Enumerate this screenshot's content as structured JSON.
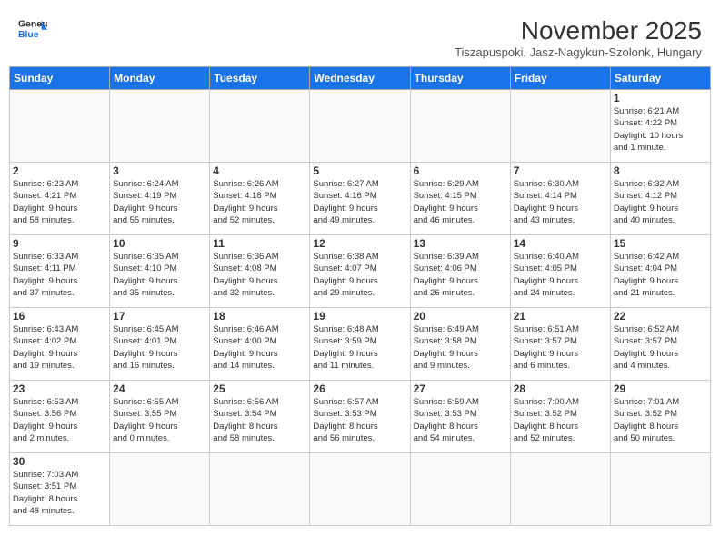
{
  "logo": {
    "text_general": "General",
    "text_blue": "Blue"
  },
  "title": {
    "month_year": "November 2025",
    "location": "Tiszapuspoki, Jasz-Nagykun-Szolonk, Hungary"
  },
  "days_of_week": [
    "Sunday",
    "Monday",
    "Tuesday",
    "Wednesday",
    "Thursday",
    "Friday",
    "Saturday"
  ],
  "weeks": [
    [
      {
        "day": "",
        "info": ""
      },
      {
        "day": "",
        "info": ""
      },
      {
        "day": "",
        "info": ""
      },
      {
        "day": "",
        "info": ""
      },
      {
        "day": "",
        "info": ""
      },
      {
        "day": "",
        "info": ""
      },
      {
        "day": "1",
        "info": "Sunrise: 6:21 AM\nSunset: 4:22 PM\nDaylight: 10 hours\nand 1 minute."
      }
    ],
    [
      {
        "day": "2",
        "info": "Sunrise: 6:23 AM\nSunset: 4:21 PM\nDaylight: 9 hours\nand 58 minutes."
      },
      {
        "day": "3",
        "info": "Sunrise: 6:24 AM\nSunset: 4:19 PM\nDaylight: 9 hours\nand 55 minutes."
      },
      {
        "day": "4",
        "info": "Sunrise: 6:26 AM\nSunset: 4:18 PM\nDaylight: 9 hours\nand 52 minutes."
      },
      {
        "day": "5",
        "info": "Sunrise: 6:27 AM\nSunset: 4:16 PM\nDaylight: 9 hours\nand 49 minutes."
      },
      {
        "day": "6",
        "info": "Sunrise: 6:29 AM\nSunset: 4:15 PM\nDaylight: 9 hours\nand 46 minutes."
      },
      {
        "day": "7",
        "info": "Sunrise: 6:30 AM\nSunset: 4:14 PM\nDaylight: 9 hours\nand 43 minutes."
      },
      {
        "day": "8",
        "info": "Sunrise: 6:32 AM\nSunset: 4:12 PM\nDaylight: 9 hours\nand 40 minutes."
      }
    ],
    [
      {
        "day": "9",
        "info": "Sunrise: 6:33 AM\nSunset: 4:11 PM\nDaylight: 9 hours\nand 37 minutes."
      },
      {
        "day": "10",
        "info": "Sunrise: 6:35 AM\nSunset: 4:10 PM\nDaylight: 9 hours\nand 35 minutes."
      },
      {
        "day": "11",
        "info": "Sunrise: 6:36 AM\nSunset: 4:08 PM\nDaylight: 9 hours\nand 32 minutes."
      },
      {
        "day": "12",
        "info": "Sunrise: 6:38 AM\nSunset: 4:07 PM\nDaylight: 9 hours\nand 29 minutes."
      },
      {
        "day": "13",
        "info": "Sunrise: 6:39 AM\nSunset: 4:06 PM\nDaylight: 9 hours\nand 26 minutes."
      },
      {
        "day": "14",
        "info": "Sunrise: 6:40 AM\nSunset: 4:05 PM\nDaylight: 9 hours\nand 24 minutes."
      },
      {
        "day": "15",
        "info": "Sunrise: 6:42 AM\nSunset: 4:04 PM\nDaylight: 9 hours\nand 21 minutes."
      }
    ],
    [
      {
        "day": "16",
        "info": "Sunrise: 6:43 AM\nSunset: 4:02 PM\nDaylight: 9 hours\nand 19 minutes."
      },
      {
        "day": "17",
        "info": "Sunrise: 6:45 AM\nSunset: 4:01 PM\nDaylight: 9 hours\nand 16 minutes."
      },
      {
        "day": "18",
        "info": "Sunrise: 6:46 AM\nSunset: 4:00 PM\nDaylight: 9 hours\nand 14 minutes."
      },
      {
        "day": "19",
        "info": "Sunrise: 6:48 AM\nSunset: 3:59 PM\nDaylight: 9 hours\nand 11 minutes."
      },
      {
        "day": "20",
        "info": "Sunrise: 6:49 AM\nSunset: 3:58 PM\nDaylight: 9 hours\nand 9 minutes."
      },
      {
        "day": "21",
        "info": "Sunrise: 6:51 AM\nSunset: 3:57 PM\nDaylight: 9 hours\nand 6 minutes."
      },
      {
        "day": "22",
        "info": "Sunrise: 6:52 AM\nSunset: 3:57 PM\nDaylight: 9 hours\nand 4 minutes."
      }
    ],
    [
      {
        "day": "23",
        "info": "Sunrise: 6:53 AM\nSunset: 3:56 PM\nDaylight: 9 hours\nand 2 minutes."
      },
      {
        "day": "24",
        "info": "Sunrise: 6:55 AM\nSunset: 3:55 PM\nDaylight: 9 hours\nand 0 minutes."
      },
      {
        "day": "25",
        "info": "Sunrise: 6:56 AM\nSunset: 3:54 PM\nDaylight: 8 hours\nand 58 minutes."
      },
      {
        "day": "26",
        "info": "Sunrise: 6:57 AM\nSunset: 3:53 PM\nDaylight: 8 hours\nand 56 minutes."
      },
      {
        "day": "27",
        "info": "Sunrise: 6:59 AM\nSunset: 3:53 PM\nDaylight: 8 hours\nand 54 minutes."
      },
      {
        "day": "28",
        "info": "Sunrise: 7:00 AM\nSunset: 3:52 PM\nDaylight: 8 hours\nand 52 minutes."
      },
      {
        "day": "29",
        "info": "Sunrise: 7:01 AM\nSunset: 3:52 PM\nDaylight: 8 hours\nand 50 minutes."
      }
    ],
    [
      {
        "day": "30",
        "info": "Sunrise: 7:03 AM\nSunset: 3:51 PM\nDaylight: 8 hours\nand 48 minutes."
      },
      {
        "day": "",
        "info": ""
      },
      {
        "day": "",
        "info": ""
      },
      {
        "day": "",
        "info": ""
      },
      {
        "day": "",
        "info": ""
      },
      {
        "day": "",
        "info": ""
      },
      {
        "day": "",
        "info": ""
      }
    ]
  ]
}
